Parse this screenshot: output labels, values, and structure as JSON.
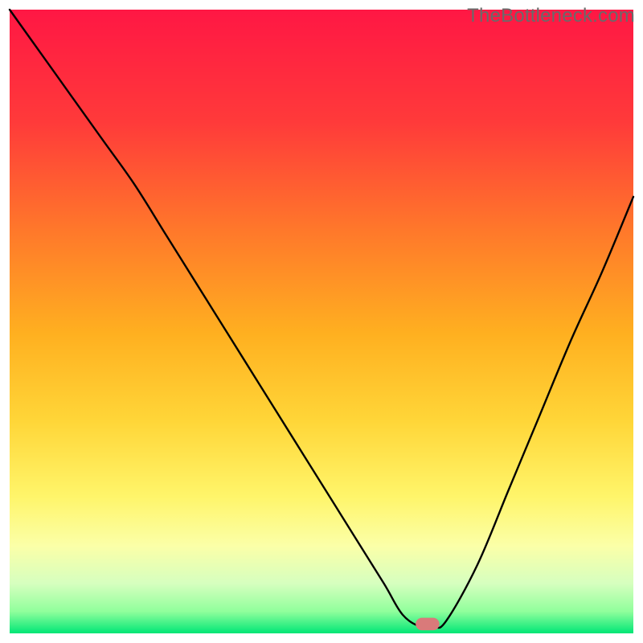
{
  "watermark": "TheBottleneck.com",
  "chart_data": {
    "type": "line",
    "title": "",
    "xlabel": "",
    "ylabel": "",
    "xlim": [
      0,
      100
    ],
    "ylim": [
      0,
      100
    ],
    "legend": false,
    "grid": false,
    "description": "V-shaped black curve over vertical red-to-green heat gradient with pink marker near trough.",
    "background_gradient_stops": [
      {
        "offset": 0.0,
        "color": "#ff1744"
      },
      {
        "offset": 0.18,
        "color": "#ff3a3a"
      },
      {
        "offset": 0.36,
        "color": "#ff7a2a"
      },
      {
        "offset": 0.52,
        "color": "#ffb020"
      },
      {
        "offset": 0.66,
        "color": "#ffd638"
      },
      {
        "offset": 0.78,
        "color": "#fff56a"
      },
      {
        "offset": 0.86,
        "color": "#fbffa8"
      },
      {
        "offset": 0.92,
        "color": "#d6ffbf"
      },
      {
        "offset": 0.965,
        "color": "#90ff9c"
      },
      {
        "offset": 1.0,
        "color": "#00e676"
      }
    ],
    "series": [
      {
        "name": "bottleneck-curve",
        "x": [
          0,
          5,
          10,
          15,
          20,
          25,
          30,
          35,
          40,
          45,
          50,
          55,
          60,
          63,
          66,
          68,
          70,
          75,
          80,
          85,
          90,
          95,
          100
        ],
        "y": [
          100,
          93,
          86,
          79,
          72,
          64,
          56,
          48,
          40,
          32,
          24,
          16,
          8,
          3,
          1,
          1,
          2,
          11,
          23,
          35,
          47,
          58,
          70
        ]
      }
    ],
    "marker": {
      "name": "highlight-pill",
      "x": 67,
      "y": 1.5,
      "color": "#d97a7a",
      "width": 3.8,
      "height": 2.0
    }
  }
}
